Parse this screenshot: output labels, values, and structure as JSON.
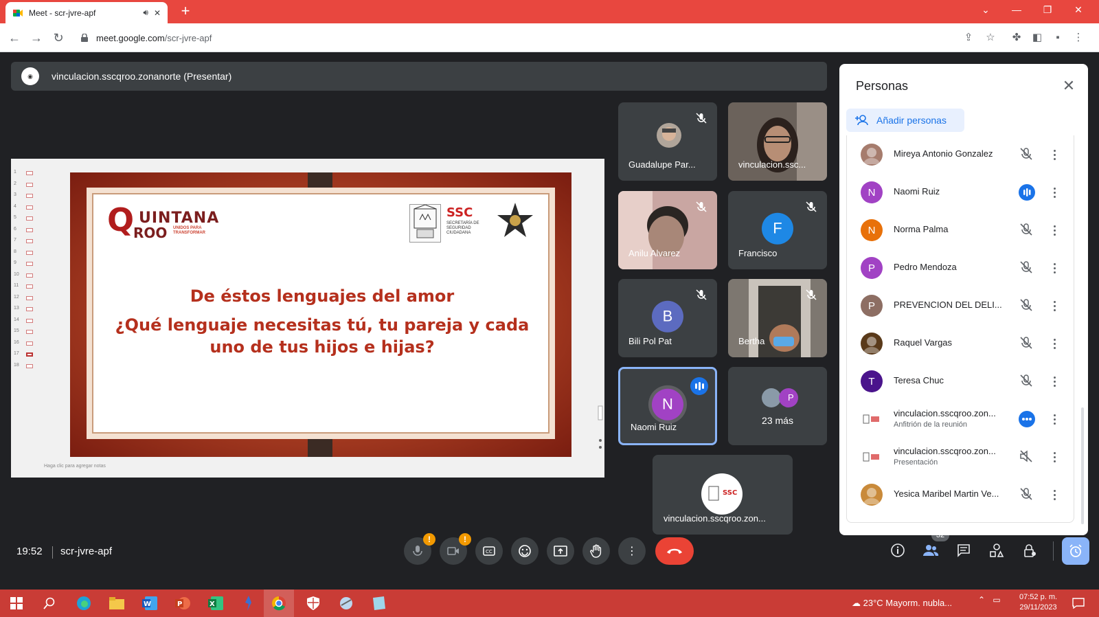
{
  "browser": {
    "tab_title": "Meet - scr-jvre-apf",
    "url_host": "meet.google.com",
    "url_path": "/scr-jvre-apf",
    "accent": "#e8473f"
  },
  "presenter_bar": {
    "label": "vinculacion.sscqroo.zonanorte (Presentar)"
  },
  "slide": {
    "notes_placeholder": "Haga clic para agregar notas",
    "slide_numbers": [
      "1",
      "2",
      "3",
      "4",
      "5",
      "6",
      "7",
      "8",
      "9",
      "10",
      "11",
      "12",
      "13",
      "14",
      "15",
      "16",
      "17",
      "18"
    ],
    "active_slide": "17",
    "logo_q": "Q",
    "logo_line1": "UINTANA",
    "logo_line2": "ROO",
    "logo_tagline": "UNIDOS PARA TRANSFORMAR",
    "ssc_title": "SSC",
    "ssc_subtitle": "SECRETARÍA DE SEGURIDAD CIUDADANA",
    "heading": "De éstos lenguajes del amor",
    "question": "¿Qué lenguaje necesitas tú, tu pareja y cada uno de tus hijos e hijas?",
    "title_color": "#b5301d"
  },
  "tiles": [
    {
      "name": "Guadalupe Par...",
      "initial": "",
      "muted": true
    },
    {
      "name": "vinculacion.ssc...",
      "initial": "",
      "muted": false
    },
    {
      "name": "Anilu Alvarez",
      "initial": "",
      "muted": true
    },
    {
      "name": "Francisco",
      "initial": "F",
      "muted": true
    },
    {
      "name": "Bili Pol Pat",
      "initial": "B",
      "muted": true
    },
    {
      "name": "Bertha",
      "initial": "",
      "muted": true
    },
    {
      "name": "Naomi Ruiz",
      "initial": "N",
      "speaking": true
    },
    {
      "name": "23 más",
      "initial": "P"
    },
    {
      "name": "vinculacion.sscqroo.zon..."
    }
  ],
  "controls": {
    "time": "19:52",
    "meeting_code": "scr-jvre-apf",
    "participant_count": "32"
  },
  "people_panel": {
    "title": "Personas",
    "add_label": "Añadir personas",
    "people": [
      {
        "name": "Mireya Antonio Gonzalez",
        "initial": "",
        "color": "#a67c6d",
        "status": "muted"
      },
      {
        "name": "Naomi Ruiz",
        "initial": "N",
        "color": "#a142c4",
        "status": "speaking"
      },
      {
        "name": "Norma Palma",
        "initial": "N",
        "color": "#e8710a",
        "status": "muted"
      },
      {
        "name": "Pedro Mendoza",
        "initial": "P",
        "color": "#a142c4",
        "status": "muted"
      },
      {
        "name": "PREVENCION DEL DELI...",
        "initial": "P",
        "color": "#8d6e63",
        "status": "muted"
      },
      {
        "name": "Raquel Vargas",
        "initial": "",
        "color": "#5a3a1a",
        "status": "muted"
      },
      {
        "name": "Teresa Chuc",
        "initial": "T",
        "color": "#4a148c",
        "status": "muted"
      },
      {
        "name": "vinculacion.sscqroo.zon...",
        "sub": "Anfitrión de la reunión",
        "initial": "",
        "color": "#ffffff",
        "status": "more"
      },
      {
        "name": "vinculacion.sscqroo.zon...",
        "sub": "Presentación",
        "initial": "",
        "color": "#ffffff",
        "status": "muted-presentation"
      },
      {
        "name": "Yesica Maribel Martin Ve...",
        "initial": "",
        "color": "#c98a3a",
        "status": "muted"
      }
    ]
  },
  "taskbar": {
    "weather_temp": "23°C",
    "weather_desc": "Mayorm. nubla...",
    "time": "07:52 p. m.",
    "date": "29/11/2023"
  }
}
